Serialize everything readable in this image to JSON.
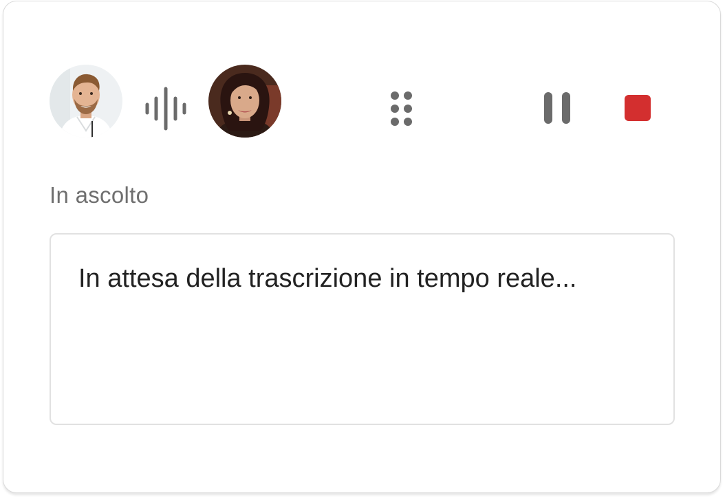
{
  "participants": [
    {
      "name_icon": "avatar-man-icon",
      "role": "speaker"
    },
    {
      "name_icon": "avatar-woman-icon",
      "role": "listener"
    }
  ],
  "icons": {
    "waveform": "audio-waveform-icon",
    "grip": "drag-handle-icon",
    "pause": "pause-icon",
    "stop": "stop-icon"
  },
  "colors": {
    "icon_gray": "#6b6b6b",
    "stop_red": "#d32f2f",
    "status_text": "#6f6f6f",
    "transcript_text": "#222222"
  },
  "status": {
    "label": "In ascolto"
  },
  "transcript": {
    "placeholder": "In attesa della trascrizione in tempo reale..."
  }
}
